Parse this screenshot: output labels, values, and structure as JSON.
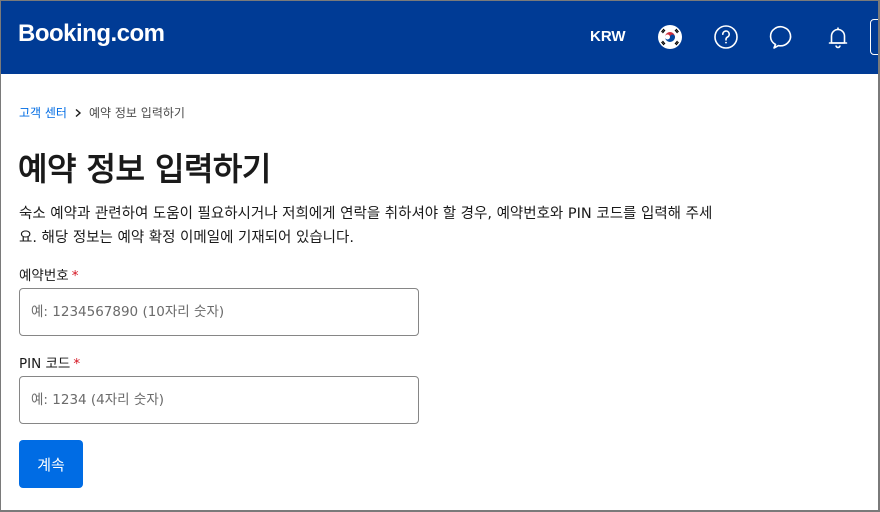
{
  "header": {
    "logo": "Booking.com",
    "currency": "KRW",
    "language_flag": "korea-flag-icon",
    "icons": [
      "question-circle-icon",
      "chat-bubble-icon",
      "bell-icon"
    ],
    "brand_color": "#003b95"
  },
  "breadcrumb": {
    "items": [
      {
        "label": "고객 센터",
        "link": true
      },
      {
        "label": "예약 정보 입력하기",
        "link": false
      }
    ]
  },
  "page": {
    "title": "예약 정보 입력하기",
    "description": "숙소 예약과 관련하여 도움이 필요하시거나 저희에게 연락을 취하셔야 할 경우, 예약번호와 PIN 코드를 입력해 주세요. 해당 정보는 예약 확정 이메일에 기재되어 있습니다."
  },
  "form": {
    "booking_number": {
      "label": "예약번호",
      "required_mark": "*",
      "value": "",
      "placeholder": "예: 1234567890 (10자리 숫자)"
    },
    "pin_code": {
      "label": "PIN 코드",
      "required_mark": "*",
      "value": "",
      "placeholder": "예: 1234 (4자리 숫자)"
    },
    "submit_label": "계속",
    "accent_color": "#006ce4"
  }
}
